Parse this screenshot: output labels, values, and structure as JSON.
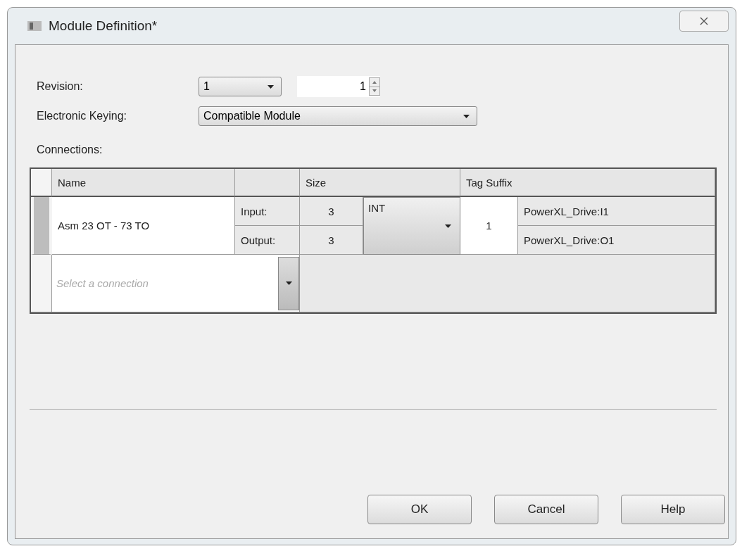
{
  "window": {
    "title": "Module Definition*"
  },
  "revision": {
    "label": "Revision:",
    "major": "1",
    "minor": "1"
  },
  "keying": {
    "label": "Electronic Keying:",
    "value": "Compatible Module"
  },
  "connections": {
    "label": "Connections:",
    "columns": [
      "Name",
      "Size",
      "Tag Suffix"
    ],
    "rows": [
      {
        "name": "Asm 23 OT - 73 TO",
        "input_label": "Input:",
        "input_size": "3",
        "output_label": "Output:",
        "output_size": "3",
        "data_type": "INT",
        "suffix": "1",
        "input_tag": "PowerXL_Drive:I1",
        "output_tag": "PowerXL_Drive:O1"
      }
    ],
    "new_row": {
      "placeholder": "Select a connection"
    }
  },
  "buttons": [
    "OK",
    "Cancel",
    "Help"
  ]
}
